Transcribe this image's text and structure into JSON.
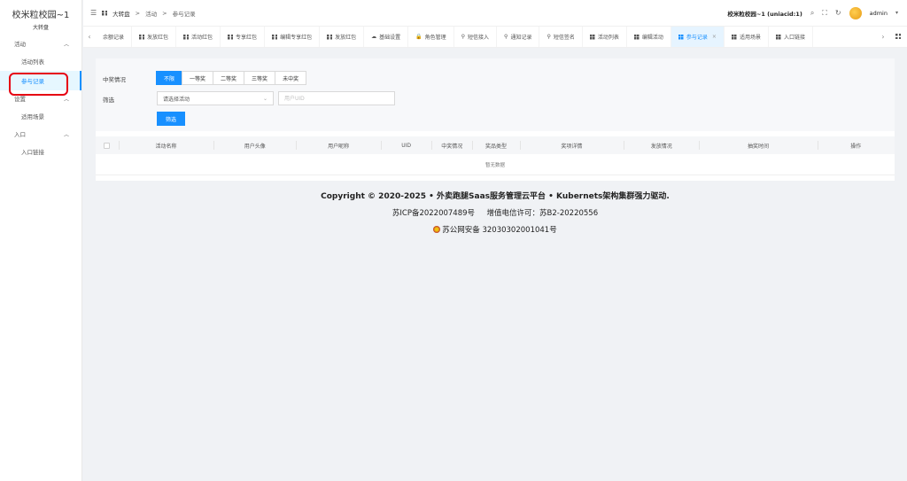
{
  "app": {
    "title": "校米粒校园~1",
    "subtitle": "大转盘"
  },
  "sidebar": {
    "groups": [
      {
        "label": "活动",
        "chevron": "chevron-up-icon",
        "items": [
          {
            "label": "活动列表"
          },
          {
            "label": "参与记录",
            "active": true
          }
        ]
      },
      {
        "label": "设置",
        "chevron": "chevron-up-icon",
        "items": [
          {
            "label": "适用场景"
          }
        ]
      },
      {
        "label": "入口",
        "chevron": "chevron-up-icon",
        "items": [
          {
            "label": "入口链接"
          }
        ]
      }
    ]
  },
  "header": {
    "breadcrumb": [
      "大转盘",
      "活动",
      "参与记录"
    ],
    "account": "校米粒校园~1 (uniacid:1)",
    "user": "admin",
    "icons": [
      "menu-fold-icon",
      "search-icon",
      "fullscreen-icon",
      "refresh-icon",
      "avatar",
      "caret-down-icon"
    ]
  },
  "tabs": [
    {
      "label": "余额记录",
      "icon": "none"
    },
    {
      "label": "发放红包",
      "icon": "grid-icon"
    },
    {
      "label": "活动红包",
      "icon": "grid-icon"
    },
    {
      "label": "专享红包",
      "icon": "grid-icon"
    },
    {
      "label": "编辑专享红包",
      "icon": "grid-icon"
    },
    {
      "label": "发放红包",
      "icon": "grid-icon"
    },
    {
      "label": "基础设置",
      "icon": "cloud-icon"
    },
    {
      "label": "角色管理",
      "icon": "lock-icon"
    },
    {
      "label": "短信接入",
      "icon": "user-icon"
    },
    {
      "label": "通知记录",
      "icon": "user-icon"
    },
    {
      "label": "短信签名",
      "icon": "user-icon"
    },
    {
      "label": "活动列表",
      "icon": "grid-icon"
    },
    {
      "label": "编辑活动",
      "icon": "grid-icon"
    },
    {
      "label": "参与记录",
      "icon": "grid-icon",
      "active": true
    },
    {
      "label": "适用场景",
      "icon": "grid-icon"
    },
    {
      "label": "入口链接",
      "icon": "grid-icon"
    }
  ],
  "filter": {
    "prize_label": "中奖情况",
    "prize_options": [
      {
        "label": "不限",
        "selected": true
      },
      {
        "label": "一等奖"
      },
      {
        "label": "二等奖"
      },
      {
        "label": "三等奖"
      },
      {
        "label": "未中奖"
      }
    ],
    "filter_label": "筛选",
    "activity_select": "请选择活动",
    "uid_placeholder": "用户UID",
    "submit": "筛选"
  },
  "table": {
    "columns": [
      "活动名称",
      "用户头像",
      "用户昵称",
      "UID",
      "中奖情况",
      "奖品类型",
      "奖项详情",
      "发放情况",
      "抽奖时间",
      "操作"
    ],
    "empty_text": "暂无数据"
  },
  "footer": {
    "copyright": "Copyright © 2020-2025 • 外卖跑腿Saas服务管理云平台 • Kubernets架构集群强力驱动.",
    "icp": "苏ICP备2022007489号",
    "license": "增值电信许可：苏B2-20220556",
    "police": "苏公网安备 32030302001041号"
  },
  "colors": {
    "primary": "#1890ff",
    "highlight": "#e60012"
  }
}
